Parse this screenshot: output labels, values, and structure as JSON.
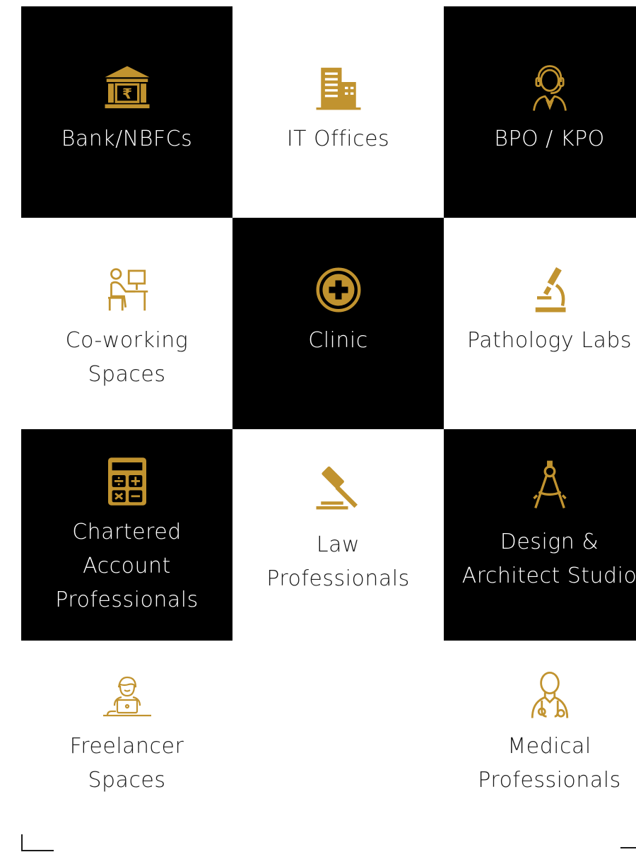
{
  "accent_color": "#c1932f",
  "tiles": [
    {
      "label": "Bank/NBFCs",
      "icon": "bank-icon",
      "theme": "dark"
    },
    {
      "label": "IT Offices",
      "icon": "office-building-icon",
      "theme": "light"
    },
    {
      "label": "BPO / KPO",
      "icon": "headset-agent-icon",
      "theme": "dark"
    },
    {
      "label": "Co-working\nSpaces",
      "icon": "person-at-desk-icon",
      "theme": "light"
    },
    {
      "label": "Clinic",
      "icon": "medical-cross-icon",
      "theme": "dark"
    },
    {
      "label": "Pathology Labs",
      "icon": "microscope-icon",
      "theme": "light"
    },
    {
      "label": "Chartered\nAccount\nProfessionals",
      "icon": "calculator-icon",
      "theme": "dark"
    },
    {
      "label": "Law\nProfessionals",
      "icon": "gavel-icon",
      "theme": "light"
    },
    {
      "label": "Design &\nArchitect Studio",
      "icon": "drafting-compass-icon",
      "theme": "dark"
    },
    {
      "label": "Freelancer\nSpaces",
      "icon": "freelancer-laptop-icon",
      "theme": "light"
    },
    {
      "label": "Medical\nProfessionals",
      "icon": "doctor-stethoscope-icon",
      "theme": "light"
    }
  ]
}
